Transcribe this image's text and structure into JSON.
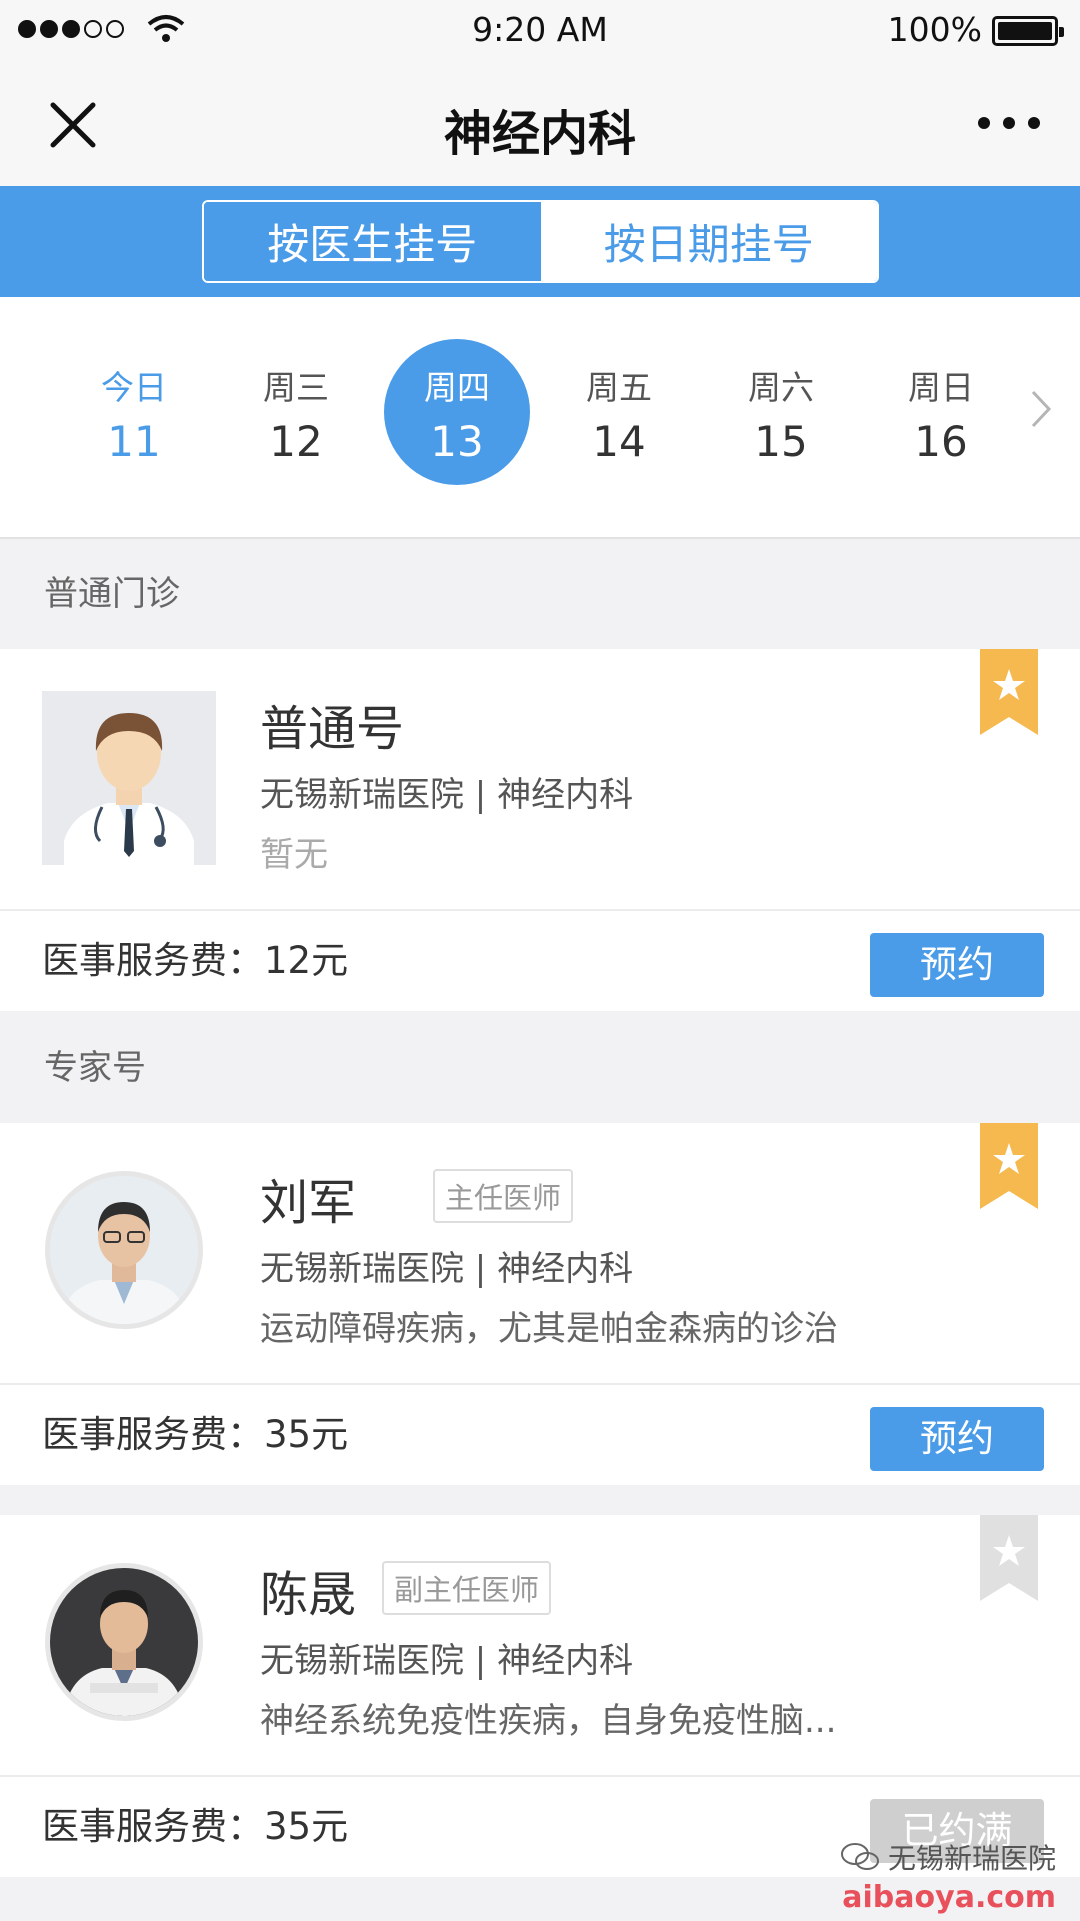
{
  "status_bar": {
    "time": "9:20 AM",
    "battery": "100%"
  },
  "nav": {
    "title": "神经内科"
  },
  "segment": {
    "by_doctor": "按医生挂号",
    "by_date": "按日期挂号"
  },
  "dates": [
    {
      "weekday": "今日",
      "day": "11",
      "state": "today"
    },
    {
      "weekday": "周三",
      "day": "12",
      "state": "normal"
    },
    {
      "weekday": "周四",
      "day": "13",
      "state": "selected"
    },
    {
      "weekday": "周五",
      "day": "14",
      "state": "normal"
    },
    {
      "weekday": "周六",
      "day": "15",
      "state": "normal"
    },
    {
      "weekday": "周日",
      "day": "16",
      "state": "normal"
    }
  ],
  "sections": {
    "general": "普通门诊",
    "expert": "专家号"
  },
  "doctors": [
    {
      "name": "普通号",
      "title": "",
      "hospital": "无锡新瑞医院 | 神经内科",
      "desc": "暂无",
      "fee": "医事服务费：12元",
      "button": "预约",
      "bookmarked": true
    },
    {
      "name": "刘军",
      "title": "主任医师",
      "hospital": "无锡新瑞医院 | 神经内科",
      "desc": "运动障碍疾病，尤其是帕金森病的诊治",
      "fee": "医事服务费：35元",
      "button": "预约",
      "bookmarked": true
    },
    {
      "name": "陈晟",
      "title": "副主任医师",
      "hospital": "无锡新瑞医院 | 神经内科",
      "desc": "神经系统免疫性疾病，自身免疫性脑...",
      "fee": "医事服务费：35元",
      "button": "已约满",
      "bookmarked": false
    }
  ],
  "watermark": {
    "line1": "无锡新瑞医院",
    "line2": "aibaoya.com"
  },
  "colors": {
    "accent": "#4a9be8",
    "bookmark_on": "#f5b94f",
    "bookmark_off": "#e0e0e0"
  }
}
